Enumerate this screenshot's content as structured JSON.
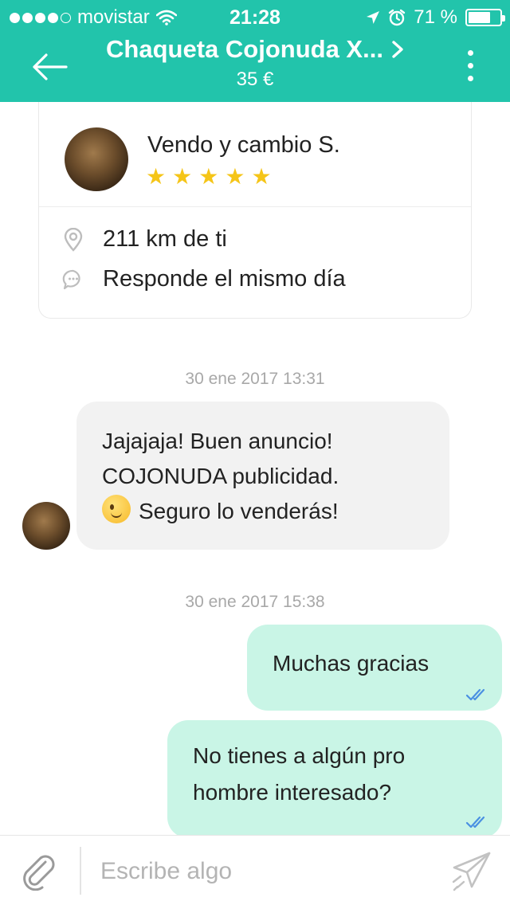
{
  "status_bar": {
    "carrier": "movistar",
    "time": "21:28",
    "battery": "71 %",
    "battery_level": 0.71
  },
  "header": {
    "title": "Chaqueta Cojonuda X...",
    "price": "35 €",
    "accent_color": "#22c4ab"
  },
  "seller": {
    "name": "Vendo y cambio S.",
    "rating": 5,
    "rating_max": 5,
    "distance": "211 km de ti",
    "response": "Responde el mismo día"
  },
  "messages": {
    "ts1": "30 ene 2017 13:31",
    "incoming": {
      "line1": "Jajajaja! Buen anuncio!",
      "line2": "COJONUDA publicidad.",
      "line3": "Seguro lo venderás!"
    },
    "ts2": "30 ene 2017 15:38",
    "out1": "Muchas gracias",
    "out2_line1": "No tienes a algún pro",
    "out2_line2": "hombre interesado?"
  },
  "composer": {
    "placeholder": "Escribe algo"
  },
  "icons": {
    "back": "arrow-left-icon",
    "chevron": "chevron-right-icon",
    "menu": "more-vertical-icon",
    "location": "location-pin-icon",
    "chat": "chat-bubble-icon",
    "attach": "paperclip-icon",
    "send": "paper-plane-icon",
    "read": "double-check-icon",
    "wink": "wink-emoji-icon",
    "wifi": "wifi-icon",
    "location_arrow": "location-arrow-icon",
    "alarm": "alarm-icon"
  }
}
